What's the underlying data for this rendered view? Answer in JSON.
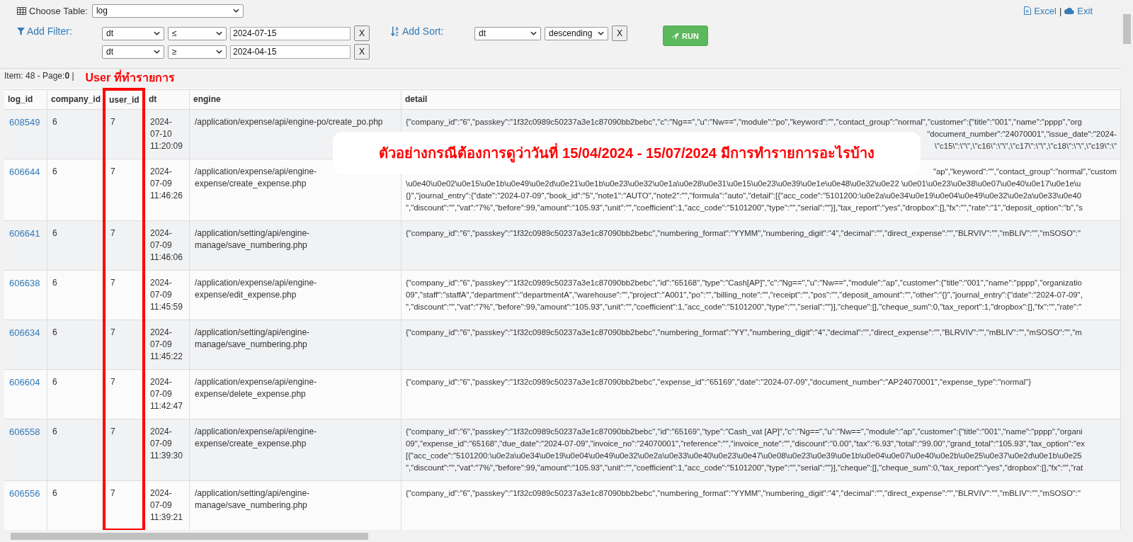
{
  "toolbar": {
    "choose_table_label": "Choose Table:",
    "table_select": "log",
    "excel_link": "Excel",
    "separator": "|",
    "exit_link": "Exit"
  },
  "filters": {
    "label": "Add Filter:",
    "rows": [
      {
        "field": "dt",
        "operator": "≤",
        "value": "2024-07-15",
        "remove": "X"
      },
      {
        "field": "dt",
        "operator": "≥",
        "value": "2024-04-15",
        "remove": "X"
      }
    ]
  },
  "sort": {
    "label": "Add Sort:",
    "field": "dt",
    "direction": "descending",
    "remove": "X"
  },
  "run_button": "RUN",
  "status": "Item: 48 - Page:**0** |",
  "annotation": {
    "label": "User ที่ทำรายการ"
  },
  "callout": "ตัวอย่างกรณีต้องการดูว่าวันที่ 15/04/2024 - 15/07/2024 มีการทำรายการอะไรบ้าง",
  "table": {
    "columns": [
      {
        "name": "log_id",
        "highlighted": false
      },
      {
        "name": "company_id",
        "highlighted": false
      },
      {
        "name": "user_id",
        "highlighted": true
      },
      {
        "name": "dt",
        "highlighted": false
      },
      {
        "name": "engine",
        "highlighted": false
      },
      {
        "name": "detail",
        "highlighted": false
      }
    ],
    "rows": [
      {
        "log_id": "608549",
        "company_id": "6",
        "user_id": "7",
        "dt": "2024-07-10 11:20:09",
        "engine": "/application/expense/api/engine-po/create_po.php",
        "detail": [
          {
            "kind": "line",
            "text": "{\"company_id\":\"6\",\"passkey\":\"1f32c0989c50237a3e1c87090bb2bebc\",\"c\":\"Ng==\",\"u\":\"Nw==\",\"module\":\"po\",\"keyword\":\"\",\"contact_group\":\"normal\",\"customer\":{\"title\":\"001\",\"name\":\"pppp\",\"org"
          },
          {
            "kind": "tail",
            "text": "\"document_number\":\"24070001\",\"issue_date\":\"2024-"
          },
          {
            "kind": "tail",
            "text": "\\\"c15\\\":\\\"\\\",\\\"c16\\\":\\\"\\\",\\\"c17\\\":\\\"\\\",\\\"c18\\\":\\\"\\\",\\\"c19\\\":\\\""
          }
        ]
      },
      {
        "log_id": "606644",
        "company_id": "6",
        "user_id": "7",
        "dt": "2024-07-09 11:46:26",
        "engine": "/application/expense/api/engine-expense/create_expense.php",
        "detail": [
          {
            "kind": "tail",
            "text": "\"ap\",\"keyword\":\"\",\"contact_group\":\"normal\",\"custom"
          },
          {
            "kind": "line",
            "text": "\\u0e40\\u0e02\\u0e15\\u0e1b\\u0e49\\u0e2d\\u0e21\\u0e1b\\u0e23\\u0e32\\u0e1a\\u0e28\\u0e31\\u0e15\\u0e23\\u0e39\\u0e1e\\u0e48\\u0e32\\u0e22 \\u0e01\\u0e23\\u0e38\\u0e07\\u0e40\\u0e17\\u0e1e\\u"
          },
          {
            "kind": "line",
            "text": "{}\",\"journal_entry\":{\"date\":\"2024-07-09\",\"book_id\":\"5\",\"note1\":\"AUTO\",\"note2\":\"\",\"formula\":\"auto\",\"detail\":[{\"acc_code\":\"5101200:\\u0e2a\\u0e34\\u0e19\\u0e04\\u0e49\\u0e32\\u0e2a\\u0e33\\u0e40"
          },
          {
            "kind": "line",
            "text": "\",\"discount\":\"\",\"vat\":\"7%\",\"before\":99,\"amount\":\"105.93\",\"unit\":\"\",\"coefficient\":1,\"acc_code\":\"5101200\",\"type\":\"\",\"serial\":\"\"}],\"tax_report\":\"yes\",\"dropbox\":[],\"fx\":\"\",\"rate\":\"1\",\"deposit_option\":\"b\",\"s"
          }
        ]
      },
      {
        "log_id": "606641",
        "company_id": "6",
        "user_id": "7",
        "dt": "2024-07-09 11:46:06",
        "engine": "/application/setting/api/engine-manage/save_numbering.php",
        "detail": [
          {
            "kind": "line",
            "text": "{\"company_id\":\"6\",\"passkey\":\"1f32c0989c50237a3e1c87090bb2bebc\",\"numbering_format\":\"YYMM\",\"numbering_digit\":\"4\",\"decimal\":\"\",\"direct_expense\":\"\",\"BLRVIV\":\"\",\"mBLIV\":\"\",\"mSOSO\":\""
          }
        ]
      },
      {
        "log_id": "606638",
        "company_id": "6",
        "user_id": "7",
        "dt": "2024-07-09 11:45:59",
        "engine": "/application/expense/api/engine-expense/edit_expense.php",
        "detail": [
          {
            "kind": "line",
            "text": "{\"company_id\":\"6\",\"passkey\":\"1f32c0989c50237a3e1c87090bb2bebc\",\"id\":\"65168\",\"type\":\"Cash[AP]\",\"c\":\"Ng==\",\"u\":\"Nw==\",\"module\":\"ap\",\"customer\":{\"title\":\"001\",\"name\":\"pppp\",\"organizatio"
          },
          {
            "kind": "line",
            "text": "09\",\"staff\":\"staffA\",\"department\":\"departmentA\",\"warehouse\":\"\",\"project\":\"A001\",\"po\":\"\",\"billing_note\":\"\",\"receipt\":\"\",\"pos\":\"\",\"deposit_amount\":\"\",\"other\":\"{}\",\"journal_entry\":{\"date\":\"2024-07-09\","
          },
          {
            "kind": "line",
            "text": "\",\"discount\":\"\",\"vat\":\"7%\",\"before\":99,\"amount\":\"105.93\",\"unit\":\"\",\"coefficient\":1,\"acc_code\":\"5101200\",\"type\":\"\",\"serial\":\"\"}],\"cheque\":[],\"cheque_sum\":0,\"tax_report\":1,\"dropbox\":[],\"fx\":\"\",\"rate\":\""
          }
        ]
      },
      {
        "log_id": "606634",
        "company_id": "6",
        "user_id": "7",
        "dt": "2024-07-09 11:45:22",
        "engine": "/application/setting/api/engine-manage/save_numbering.php",
        "detail": [
          {
            "kind": "line",
            "text": "{\"company_id\":\"6\",\"passkey\":\"1f32c0989c50237a3e1c87090bb2bebc\",\"numbering_format\":\"YY\",\"numbering_digit\":\"4\",\"decimal\":\"\",\"direct_expense\":\"\",\"BLRVIV\":\"\",\"mBLIV\":\"\",\"mSOSO\":\"\",\"m"
          }
        ]
      },
      {
        "log_id": "606604",
        "company_id": "6",
        "user_id": "7",
        "dt": "2024-07-09 11:42:47",
        "engine": "/application/expense/api/engine-expense/delete_expense.php",
        "detail": [
          {
            "kind": "line",
            "text": "{\"company_id\":\"6\",\"passkey\":\"1f32c0989c50237a3e1c87090bb2bebc\",\"expense_id\":\"65169\",\"date\":\"2024-07-09\",\"document_number\":\"AP24070001\",\"expense_type\":\"normal\"}"
          }
        ]
      },
      {
        "log_id": "606558",
        "company_id": "6",
        "user_id": "7",
        "dt": "2024-07-09 11:39:30",
        "engine": "/application/expense/api/engine-expense/create_expense.php",
        "detail": [
          {
            "kind": "line",
            "text": "{\"company_id\":\"6\",\"passkey\":\"1f32c0989c50237a3e1c87090bb2bebc\",\"id\":\"65169\",\"type\":\"Cash_vat [AP]\",\"c\":\"Ng==\",\"u\":\"Nw==\",\"module\":\"ap\",\"customer\":{\"title\":\"001\",\"name\":\"pppp\",\"organi"
          },
          {
            "kind": "line",
            "text": "09\",\"expense_id\":\"65168\",\"due_date\":\"2024-07-09\",\"invoice_no\":\"24070001\",\"reference\":\"\",\"invoice_note\":\"\",\"discount\":\"0.00\",\"tax\":\"6.93\",\"total\":\"99.00\",\"grand_total\":\"105.93\",\"tax_option\":\"ex"
          },
          {
            "kind": "line",
            "text": "[{\"acc_code\":\"5101200:\\u0e2a\\u0e34\\u0e19\\u0e04\\u0e49\\u0e32\\u0e2a\\u0e33\\u0e40\\u0e23\\u0e47\\u0e08\\u0e23\\u0e39\\u0e1b\\u0e04\\u0e07\\u0e40\\u0e2b\\u0e25\\u0e37\\u0e2d\\u0e1b\\u0e25"
          },
          {
            "kind": "line",
            "text": "\",\"discount\":\"\",\"vat\":\"7%\",\"before\":99,\"amount\":\"105.93\",\"unit\":\"\",\"coefficient\":1,\"acc_code\":\"5101200\",\"type\":\"\",\"serial\":\"\"}],\"cheque\":[],\"cheque_sum\":0,\"tax_report\":\"yes\",\"dropbox\":[],\"fx\":\"\",\"rat"
          }
        ]
      },
      {
        "log_id": "606556",
        "company_id": "6",
        "user_id": "7",
        "dt": "2024-07-09 11:39:21",
        "engine": "/application/setting/api/engine-manage/save_numbering.php",
        "detail": [
          {
            "kind": "line",
            "text": "{\"company_id\":\"6\",\"passkey\":\"1f32c0989c50237a3e1c87090bb2bebc\",\"numbering_format\":\"YYMM\",\"numbering_digit\":\"4\",\"decimal\":\"\",\"direct_expense\":\"\",\"BLRVIV\":\"\",\"mBLIV\":\"\",\"mSOSO\":\""
          }
        ]
      }
    ]
  }
}
